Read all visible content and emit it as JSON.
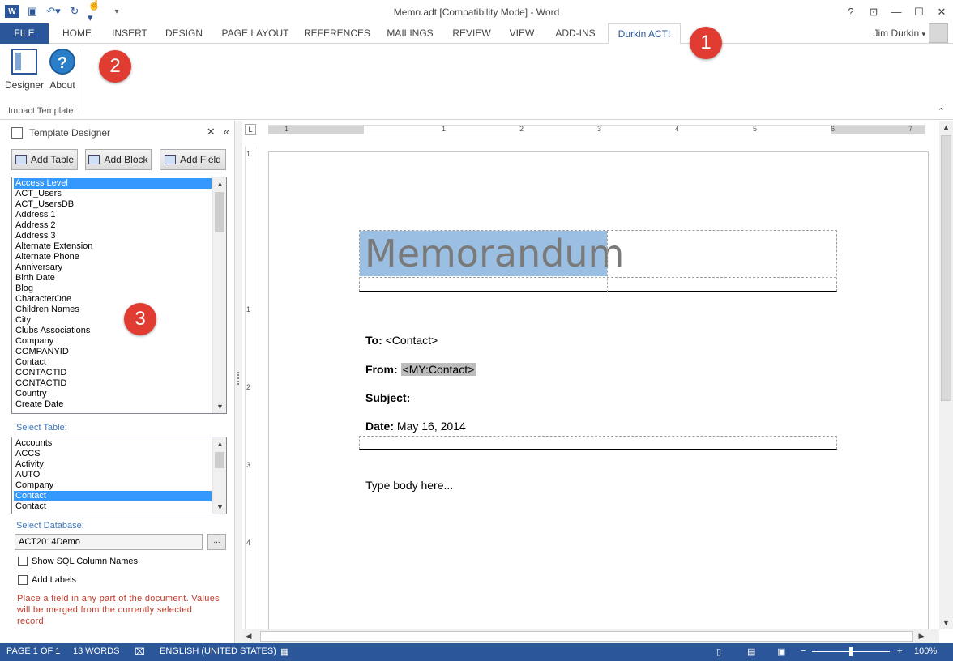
{
  "window": {
    "title": "Memo.adt [Compatibility Mode] - Word",
    "help_label": "?",
    "qat": {
      "app_icon": "word-icon",
      "save_icon": "save-icon",
      "undo_icon": "undo-icon",
      "redo_icon": "redo-icon",
      "touch_icon": "touch-mode-icon",
      "customize_icon": "customize-qat-icon"
    }
  },
  "ribbon": {
    "tabs": [
      "FILE",
      "HOME",
      "INSERT",
      "DESIGN",
      "PAGE LAYOUT",
      "REFERENCES",
      "MAILINGS",
      "REVIEW",
      "VIEW",
      "ADD-INS",
      "Durkin ACT!"
    ],
    "active_tab": "Durkin ACT!",
    "user_name": "Jim Durkin",
    "buttons": {
      "designer": "Designer",
      "about": "About",
      "about_glyph": "?"
    },
    "group_label": "Impact Template"
  },
  "badges": [
    "1",
    "2",
    "3"
  ],
  "pane": {
    "title": "Template Designer",
    "buttons": {
      "add_table": "Add Table",
      "add_block": "Add Block",
      "add_field": "Add Field"
    },
    "fields": [
      "Access Level",
      "ACT_Users",
      "ACT_UsersDB",
      "Address 1",
      "Address 2",
      "Address 3",
      "Alternate Extension",
      "Alternate Phone",
      "Anniversary",
      "Birth Date",
      "Blog",
      "CharacterOne",
      "Children Names",
      "City",
      "Clubs Associations",
      "Company",
      "COMPANYID",
      "Contact",
      "CONTACTID",
      "CONTACTID",
      "Country",
      "Create Date"
    ],
    "selected_field": "Access Level",
    "select_table_label": "Select Table:",
    "tables": [
      "Accounts",
      "ACCS",
      "Activity",
      "AUTO",
      "Company",
      "Contact",
      "Contact"
    ],
    "selected_table_index": 5,
    "select_database_label": "Select Database:",
    "database": "ACT2014Demo",
    "browse_label": "...",
    "show_sql_label": "Show SQL Column Names",
    "add_labels_label": "Add Labels",
    "hint": "Place a field in any part of the document. Values will be merged from the currently selected record."
  },
  "document": {
    "ruler_corner": "L",
    "hruler_numbers": [
      "1",
      "1",
      "2",
      "3",
      "4",
      "5",
      "6",
      "7"
    ],
    "vruler_numbers": [
      "1",
      "1",
      "2",
      "3",
      "4"
    ],
    "heading": "Memorandum",
    "to_label": "To:",
    "to_value": "<Contact>",
    "from_label": "From:",
    "from_value": "<MY:Contact>",
    "subject_label": "Subject:",
    "date_label": "Date:",
    "date_value": "May 16, 2014",
    "body": "Type body here..."
  },
  "status": {
    "page": "PAGE 1 OF 1",
    "words": "13 WORDS",
    "language": "ENGLISH (UNITED STATES)",
    "zoom": "100%",
    "zoom_minus": "−",
    "zoom_plus": "+"
  },
  "colors": {
    "accent": "#2b579a",
    "badge": "#e03c31",
    "selection": "#3399ff",
    "heading_highlight": "#9bbfe2",
    "hint": "#c0392b"
  }
}
